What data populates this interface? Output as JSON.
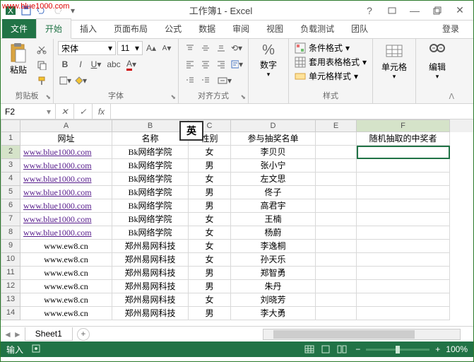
{
  "watermark": "www.blue1000.com",
  "title": "工作簿1 - Excel",
  "tabs": {
    "file": "文件",
    "home": "开始",
    "insert": "插入",
    "layout": "页面布局",
    "formulas": "公式",
    "data": "数据",
    "review": "审阅",
    "view": "视图",
    "loadtest": "负载测试",
    "team": "团队",
    "login": "登录"
  },
  "ribbon": {
    "clipboard": {
      "paste": "粘贴",
      "label": "剪贴板"
    },
    "font": {
      "name": "宋体",
      "size": "11",
      "label": "字体"
    },
    "align": {
      "label": "对齐方式"
    },
    "number": {
      "btn": "数字",
      "label": ""
    },
    "styles": {
      "condfmt": "条件格式",
      "tablefmt": "套用表格格式",
      "cellstyle": "单元格样式",
      "label": "样式"
    },
    "cells": {
      "btn": "单元格"
    },
    "editing": {
      "btn": "编辑"
    }
  },
  "namebox": "F2",
  "ime": "英",
  "headers": {
    "A": "网址",
    "B": "名称",
    "C": "性别",
    "D": "参与抽奖名单",
    "F": "随机抽取的中奖者"
  },
  "rows": [
    {
      "n": 2,
      "a": "www.blue1000.com",
      "b": "Bk网络学院",
      "c": "女",
      "d": "李贝贝",
      "link": true
    },
    {
      "n": 3,
      "a": "www.blue1000.com",
      "b": "Bk网络学院",
      "c": "男",
      "d": "张小宁",
      "link": true
    },
    {
      "n": 4,
      "a": "www.blue1000.com",
      "b": "Bk网络学院",
      "c": "女",
      "d": "左文思",
      "link": true
    },
    {
      "n": 5,
      "a": "www.blue1000.com",
      "b": "Bk网络学院",
      "c": "男",
      "d": "佟子",
      "link": true
    },
    {
      "n": 6,
      "a": "www.blue1000.com",
      "b": "Bk网络学院",
      "c": "男",
      "d": "高君宇",
      "link": true
    },
    {
      "n": 7,
      "a": "www.blue1000.com",
      "b": "Bk网络学院",
      "c": "女",
      "d": "王楠",
      "link": true
    },
    {
      "n": 8,
      "a": "www.blue1000.com",
      "b": "Bk网络学院",
      "c": "女",
      "d": "杨蔚",
      "link": true
    },
    {
      "n": 9,
      "a": "www.ew8.cn",
      "b": "郑州易网科技",
      "c": "女",
      "d": "李逸桐",
      "link": false
    },
    {
      "n": 10,
      "a": "www.ew8.cn",
      "b": "郑州易网科技",
      "c": "女",
      "d": "孙天乐",
      "link": false
    },
    {
      "n": 11,
      "a": "www.ew8.cn",
      "b": "郑州易网科技",
      "c": "男",
      "d": "郑智勇",
      "link": false
    },
    {
      "n": 12,
      "a": "www.ew8.cn",
      "b": "郑州易网科技",
      "c": "男",
      "d": "朱丹",
      "link": false
    },
    {
      "n": 13,
      "a": "www.ew8.cn",
      "b": "郑州易网科技",
      "c": "女",
      "d": "刘晓芳",
      "link": false
    },
    {
      "n": 14,
      "a": "www.ew8.cn",
      "b": "郑州易网科技",
      "c": "男",
      "d": "李大勇",
      "link": false
    }
  ],
  "sheet": "Sheet1",
  "status": {
    "mode": "输入",
    "zoom": "100%"
  }
}
